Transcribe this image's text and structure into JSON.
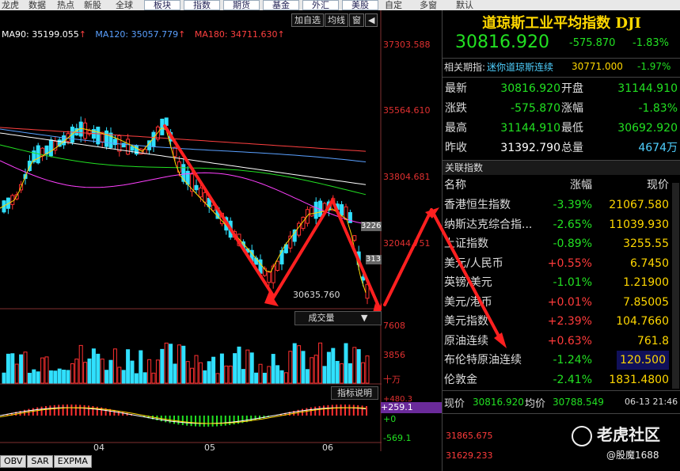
{
  "topmenu": {
    "items": [
      "龙虎",
      "数据",
      "热点",
      "新股",
      "全球"
    ],
    "buttons": [
      "板块",
      "指数",
      "期货",
      "基金",
      "外汇",
      "美股"
    ],
    "right": [
      "自定",
      "多窗",
      "默认"
    ]
  },
  "chart": {
    "toolbar": [
      "加自选",
      "均线",
      "窗"
    ],
    "ma_legend": [
      {
        "label": "MA90: 35199.055",
        "arrow": "↑",
        "color": "#ffffff"
      },
      {
        "label": "MA120: 35057.779",
        "arrow": "↑",
        "color": "#5aa0ff"
      },
      {
        "label": "MA180: 34711.630",
        "arrow": "↑",
        "color": "#ff4040"
      }
    ],
    "y_ticks": [
      "37303.588",
      "35564.610",
      "33804.681",
      "32044.751"
    ],
    "low_annotation": "30635.760",
    "side_marks": [
      "3226",
      "313"
    ],
    "vol_selector": "成交量",
    "vol_ticks": [
      "7608",
      "3856",
      "十万"
    ],
    "indicator_button": "指标说明",
    "macd_ticks": [
      "+480.3",
      "+259.1",
      "+0",
      "-569.1"
    ],
    "months": [
      "04",
      "05",
      "06"
    ],
    "bottom_tabs": [
      "OBV",
      "SAR",
      "EXPMA"
    ]
  },
  "panel": {
    "title": "道琼斯工业平均指数 DJI",
    "price": "30816.920",
    "change": "-575.870",
    "change_pct": "-1.83%",
    "related_label": "相关期指:",
    "related_name": "迷你道琼斯连续",
    "related_price": "30771.000",
    "related_pct": "-1.97%",
    "quote_rows": [
      {
        "l1": "最新",
        "v1": "30816.920",
        "c1": "green",
        "l2": "开盘",
        "v2": "31144.910",
        "c2": "green"
      },
      {
        "l1": "涨跌",
        "v1": "-575.870",
        "c1": "green",
        "l2": "涨幅",
        "v2": "-1.83%",
        "c2": "green"
      },
      {
        "l1": "最高",
        "v1": "31144.910",
        "c1": "green",
        "l2": "最低",
        "v2": "30692.920",
        "c2": "green"
      },
      {
        "l1": "昨收",
        "v1": "31392.790",
        "c1": "white",
        "l2": "总量",
        "v2": "4674万",
        "c2": "cyan"
      }
    ],
    "related_header": "关联指数",
    "rel_cols": [
      "名称",
      "涨幅",
      "现价"
    ],
    "rel_rows": [
      {
        "name": "香港恒生指数",
        "chg": "-3.39%",
        "px": "21067.580",
        "c": "green"
      },
      {
        "name": "纳斯达克综合指...",
        "chg": "-2.65%",
        "px": "11039.930",
        "c": "green"
      },
      {
        "name": "上证指数",
        "chg": "-0.89%",
        "px": "3255.55",
        "c": "green"
      },
      {
        "name": "美元/人民币",
        "chg": "+0.55%",
        "px": "6.7450",
        "c": "red"
      },
      {
        "name": "英镑/美元",
        "chg": "-1.01%",
        "px": "1.21900",
        "c": "green"
      },
      {
        "name": "美元/港币",
        "chg": "+0.01%",
        "px": "7.85005",
        "c": "red"
      },
      {
        "name": "美元指数",
        "chg": "+2.39%",
        "px": "104.7660",
        "c": "red"
      },
      {
        "name": "原油连续",
        "chg": "+0.63%",
        "px": "761.8",
        "c": "red"
      },
      {
        "name": "布伦特原油连续",
        "chg": "-1.24%",
        "px": "120.500",
        "c": "green"
      },
      {
        "name": "伦敦金",
        "chg": "-2.41%",
        "px": "1831.4800",
        "c": "green"
      }
    ],
    "tick_label": "现价",
    "tick_price": "30816.920",
    "avg_label": "均价",
    "avg_price": "30788.549",
    "tick_time": "06-13 21:46",
    "mini_ticks": [
      "31865.675",
      "31629.233"
    ]
  },
  "watermark": {
    "brand": "老虎社区",
    "user": "@股魔1688"
  },
  "colors": {
    "up": "#ff3b3b",
    "down": "#22e022",
    "title": "#ffd700",
    "arrow": "#ff2020"
  }
}
